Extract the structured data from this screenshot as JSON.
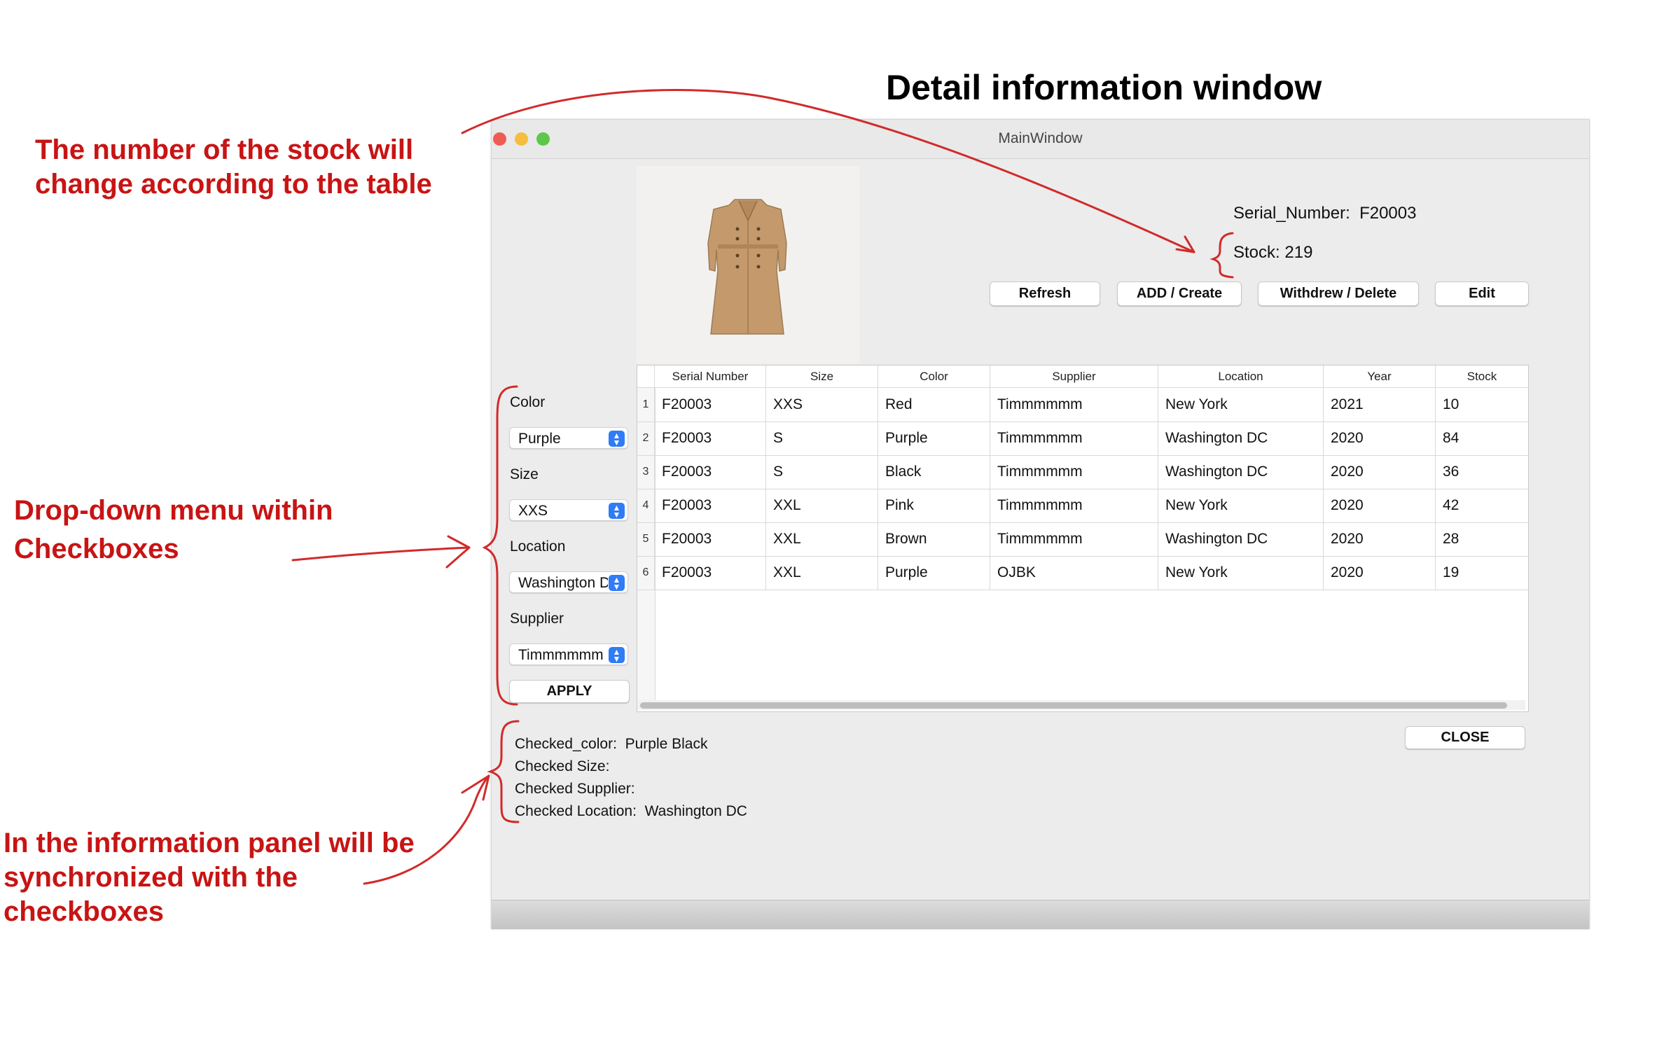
{
  "annotations": {
    "headline": "Detail information window",
    "note_stock": [
      "The number of the stock will",
      "change according to the table"
    ],
    "note_dropdown": [
      "Drop-down menu within",
      "Checkboxes"
    ],
    "note_info": [
      "In the information panel will be",
      "synchronized with the",
      "checkboxes"
    ]
  },
  "window": {
    "title": "MainWindow",
    "traffic_lights": [
      "#ee5c54",
      "#f6be3e",
      "#5cc84a"
    ]
  },
  "product": {
    "image_name": "trench-coat-image",
    "serial_label": "Serial_Number:",
    "serial_value": "F20003",
    "stock_label": "Stock:",
    "stock_value": "219"
  },
  "toolbar": {
    "refresh_label": "Refresh",
    "add_label": "ADD / Create",
    "withdraw_label": "Withdrew / Delete",
    "edit_label": "Edit"
  },
  "filters": {
    "color_label": "Color",
    "color_value": "Purple",
    "size_label": "Size",
    "size_value": "XXS",
    "location_label": "Location",
    "location_value": "Washington DC",
    "supplier_label": "Supplier",
    "supplier_value": "Timmmmmm",
    "apply_label": "APPLY"
  },
  "table": {
    "columns": [
      "Serial Number",
      "Size",
      "Color",
      "Supplier",
      "Location",
      "Year",
      "Stock"
    ],
    "rows": [
      {
        "num": "1",
        "cells": [
          "F20003",
          "XXS",
          "Red",
          "Timmmmmm",
          "New York",
          "2021",
          "10"
        ]
      },
      {
        "num": "2",
        "cells": [
          "F20003",
          "S",
          "Purple",
          "Timmmmmm",
          "Washington DC",
          "2020",
          "84"
        ]
      },
      {
        "num": "3",
        "cells": [
          "F20003",
          "S",
          "Black",
          "Timmmmmm",
          "Washington DC",
          "2020",
          "36"
        ]
      },
      {
        "num": "4",
        "cells": [
          "F20003",
          "XXL",
          "Pink",
          "Timmmmmm",
          "New York",
          "2020",
          "42"
        ]
      },
      {
        "num": "5",
        "cells": [
          "F20003",
          "XXL",
          "Brown",
          "Timmmmmm",
          "Washington DC",
          "2020",
          "28"
        ]
      },
      {
        "num": "6",
        "cells": [
          "F20003",
          "XXL",
          "Purple",
          "OJBK",
          "New York",
          "2020",
          "19"
        ]
      }
    ]
  },
  "status": {
    "checked_color_label": "Checked_color:",
    "checked_color_value": "Purple Black",
    "checked_size_label": "Checked Size:",
    "checked_supplier_label": "Checked Supplier:",
    "checked_location_label": "Checked Location:",
    "checked_location_value": "Washington DC"
  },
  "close_label": "CLOSE",
  "colors": {
    "annotation_red": "#c81414",
    "select_accent": "#2f7cf6",
    "coat": "#c49a6c"
  }
}
